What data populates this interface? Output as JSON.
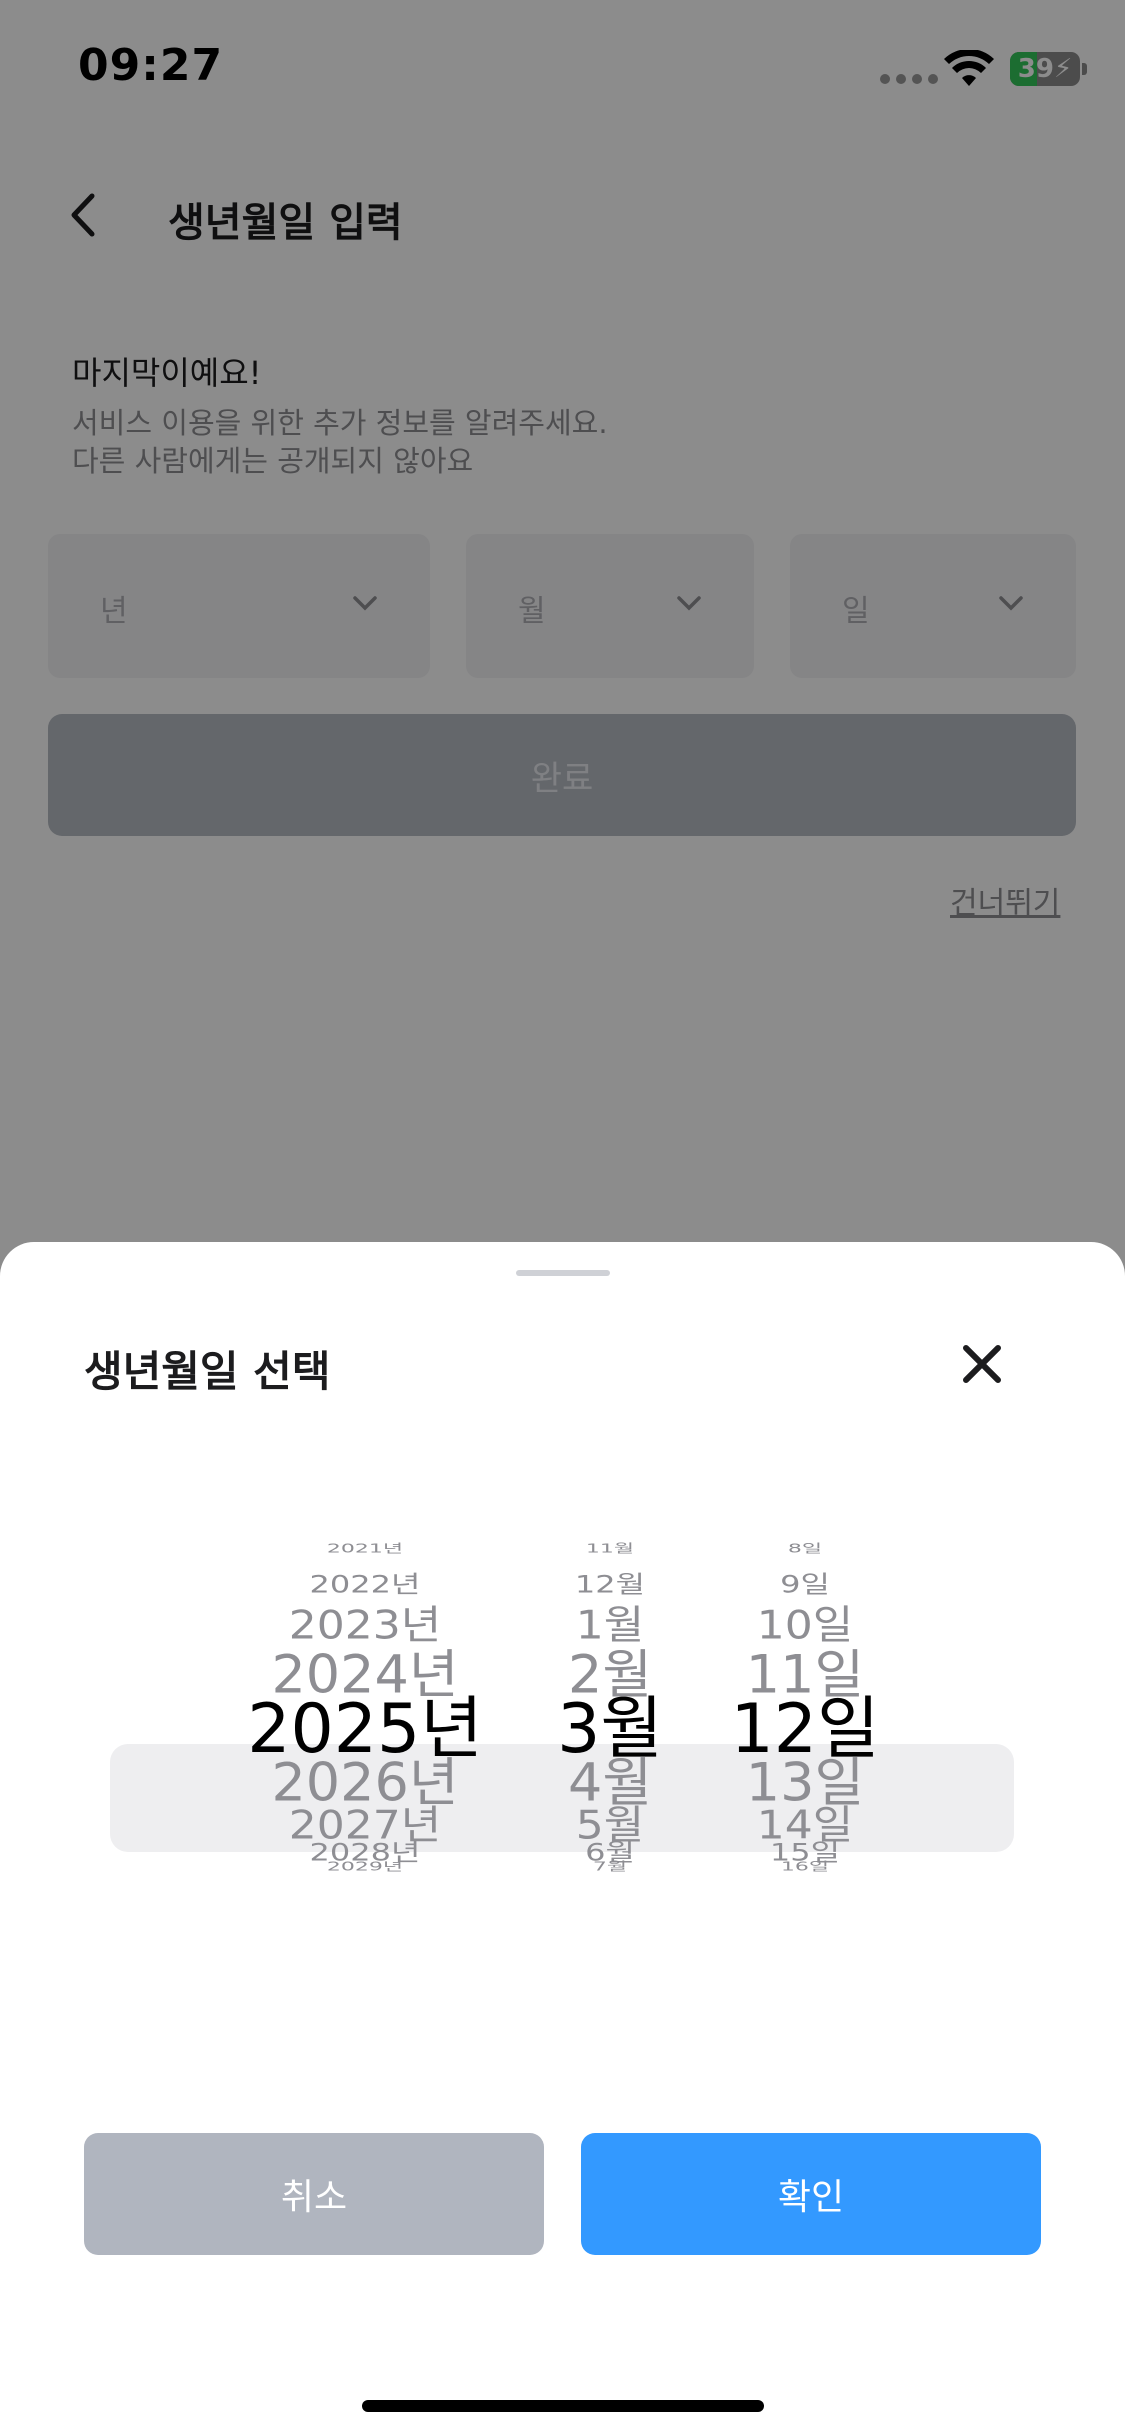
{
  "status_bar": {
    "time": "09:27",
    "battery_percent": "39",
    "battery_level": 0.39,
    "battery_color": "#34c759"
  },
  "header": {
    "back_icon": "chevron-left-icon",
    "title": "생년월일 입력"
  },
  "intro": {
    "title": "마지막이예요!",
    "description_line1": "서비스 이용을 위한 추가 정보를 알려주세요.",
    "description_line2": "다른 사람에게는 공개되지 않아요"
  },
  "selects": {
    "year_placeholder": "년",
    "month_placeholder": "월",
    "day_placeholder": "일",
    "chevron_icon": "chevron-down-icon"
  },
  "done_button": {
    "label": "완료"
  },
  "skip_link": {
    "label": "건너뛰기"
  },
  "sheet": {
    "title": "생년월일 선택",
    "close_icon": "close-icon",
    "picker": {
      "years": [
        "2021년",
        "2022년",
        "2023년",
        "2024년",
        "2025년",
        "2026년",
        "2027년",
        "2028년",
        "2029년"
      ],
      "months": [
        "11월",
        "12월",
        "1월",
        "2월",
        "3월",
        "4월",
        "5월",
        "6월",
        "7월"
      ],
      "days": [
        "8일",
        "9일",
        "10일",
        "11일",
        "12일",
        "13일",
        "14일",
        "15일",
        "16일"
      ],
      "selected_year": "2025년",
      "selected_month": "3월",
      "selected_day": "12일"
    },
    "cancel_label": "취소",
    "confirm_label": "확인",
    "confirm_color": "#3399ff",
    "cancel_color": "#b0b5bf"
  }
}
